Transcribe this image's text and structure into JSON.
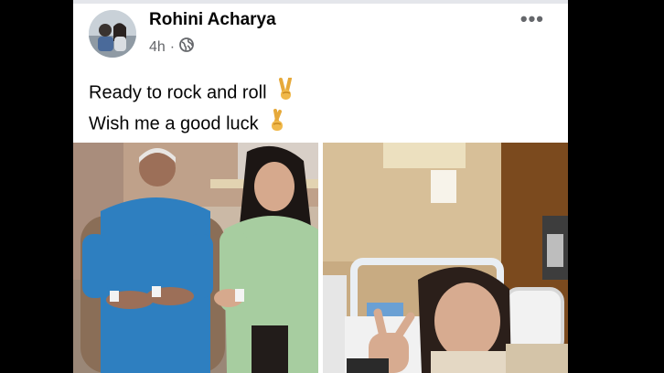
{
  "post": {
    "author": "Rohini Acharya",
    "time": "4h",
    "separator": "·",
    "more_icon": "more-horizontal-icon",
    "privacy_icon": "globe-icon",
    "text_line1": "Ready to rock and roll",
    "text_line2": "Wish me a good luck",
    "emoji1": "victory-hand-icon",
    "emoji2": "crossed-fingers-icon"
  }
}
